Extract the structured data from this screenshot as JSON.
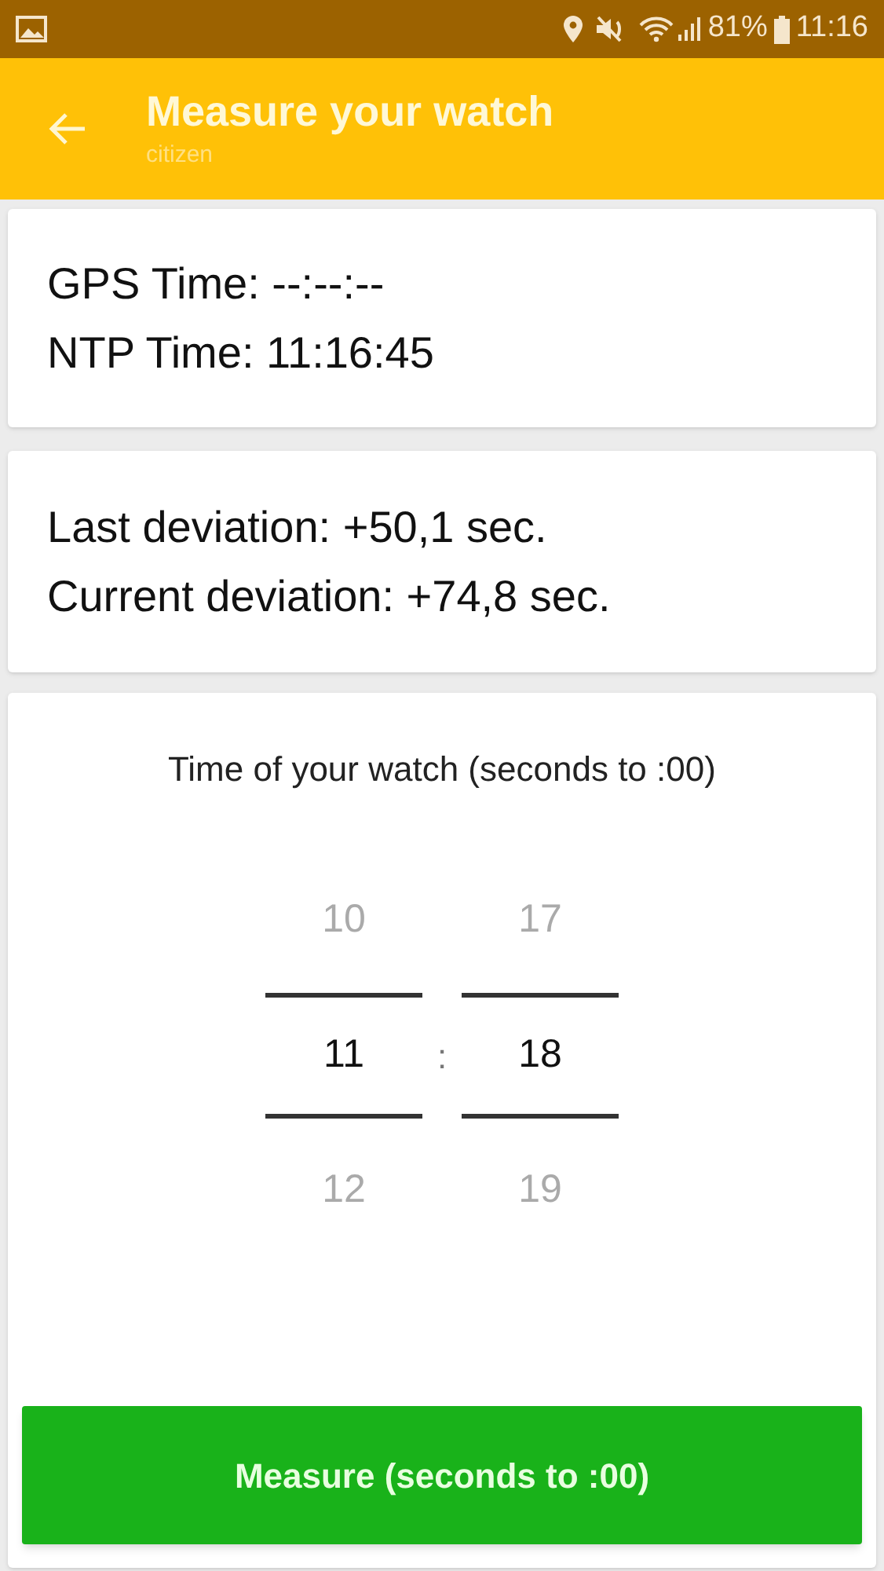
{
  "status_bar": {
    "battery": "81%",
    "time": "11:16"
  },
  "toolbar": {
    "title": "Measure your watch",
    "subtitle": "citizen"
  },
  "time_card": {
    "lines": [
      "GPS Time: --:--:--",
      "NTP Time: 11:16:45"
    ]
  },
  "deviation_card": {
    "lines": [
      "Last deviation: +50,1 sec.",
      "Current deviation: +74,8 sec."
    ]
  },
  "picker": {
    "label": "Time of your watch (seconds to :00)",
    "separator": ":",
    "columns": [
      {
        "items": [
          {
            "value": "10",
            "selected": false
          },
          {
            "value": "11",
            "selected": true
          },
          {
            "value": "12",
            "selected": false
          }
        ]
      },
      {
        "items": [
          {
            "value": "17",
            "selected": false
          },
          {
            "value": "18",
            "selected": true
          },
          {
            "value": "19",
            "selected": false
          }
        ]
      }
    ]
  },
  "button": "Measure (seconds to :00)"
}
